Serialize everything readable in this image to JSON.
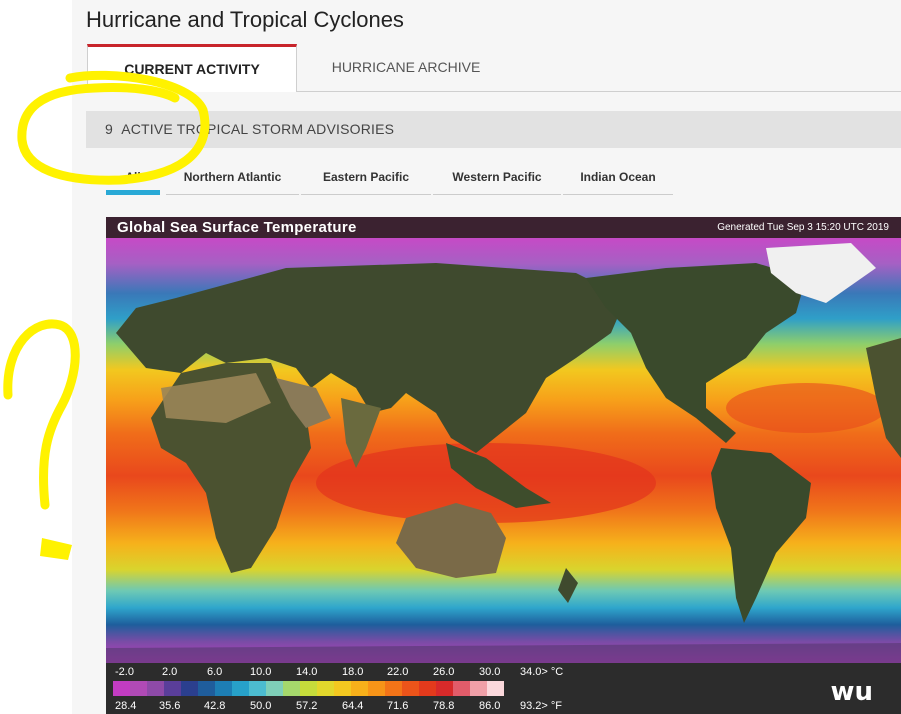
{
  "header": {
    "title": "Hurricane and Tropical Cyclones"
  },
  "tabs": [
    {
      "label": "CURRENT ACTIVITY",
      "active": true
    },
    {
      "label": "HURRICANE ARCHIVE",
      "active": false
    }
  ],
  "advisory": {
    "count": "9",
    "text": "ACTIVE TROPICAL STORM ADVISORIES"
  },
  "basins": [
    {
      "label": "All",
      "active": true
    },
    {
      "label": "Northern Atlantic"
    },
    {
      "label": "Eastern Pacific"
    },
    {
      "label": "Western Pacific"
    },
    {
      "label": "Indian Ocean"
    }
  ],
  "map": {
    "title": "Global Sea Surface Temperature",
    "generated": "Generated Tue Sep  3 15:20 UTC 2019",
    "legend_celsius": [
      "-2.0",
      "2.0",
      "6.0",
      "10.0",
      "14.0",
      "18.0",
      "22.0",
      "26.0",
      "30.0",
      "34.0> °C"
    ],
    "legend_fahrenheit": [
      "28.4",
      "35.6",
      "42.8",
      "50.0",
      "57.2",
      "64.4",
      "71.6",
      "78.8",
      "86.0",
      "93.2> °F"
    ],
    "colors": [
      "#c23cc2",
      "#b04ab6",
      "#8e4aa8",
      "#5a3e9a",
      "#2b3f8e",
      "#1f5d9c",
      "#1d7eb4",
      "#27a1c9",
      "#4cbcd0",
      "#7fcfb8",
      "#a5d86c",
      "#c6dc3b",
      "#e2d72c",
      "#f3c820",
      "#f7b01a",
      "#f79418",
      "#f37418",
      "#ec541a",
      "#e33a1c",
      "#d72a2a",
      "#e25c6a",
      "#f0a0a8",
      "#fbd8dc"
    ],
    "logo": "wu"
  },
  "palette": {
    "accent": "#c8242b",
    "active_basin": "#29a9d6",
    "highlight": "#fff200"
  }
}
